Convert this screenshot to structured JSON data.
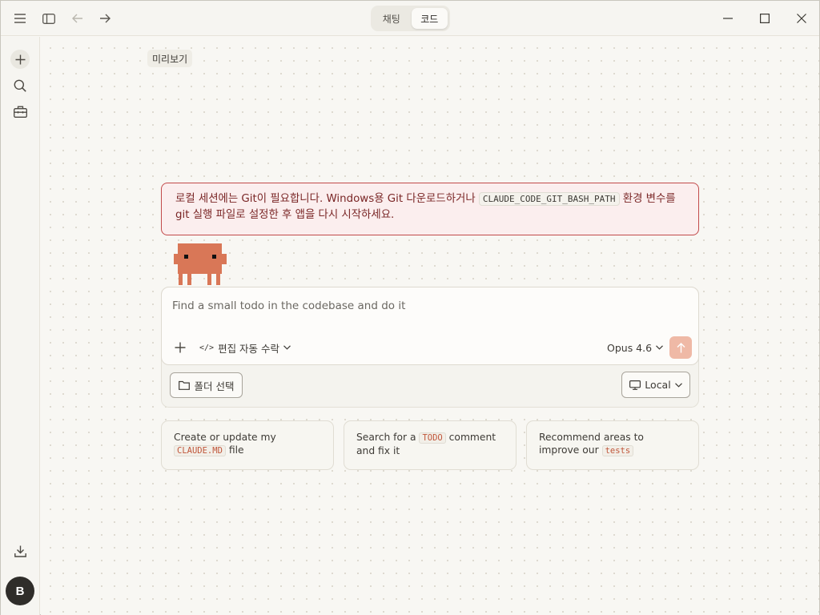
{
  "titlebar": {
    "tabs": [
      {
        "label": "채팅",
        "active": false
      },
      {
        "label": "코드",
        "active": true
      }
    ]
  },
  "icons": {
    "menu": "hamburger-menu-icon",
    "sidebar_toggle": "sidebar-panel-icon",
    "back": "arrow-left-icon",
    "forward": "arrow-right-icon",
    "minimize": "minimize-icon",
    "maximize": "maximize-icon",
    "close": "close-icon",
    "new": "plus-icon",
    "search": "search-icon",
    "tools": "toolbox-icon",
    "download": "download-icon",
    "folder": "folder-icon",
    "monitor": "monitor-icon",
    "send": "arrow-up-icon"
  },
  "sidebar": {
    "avatar_initial": "B"
  },
  "main": {
    "preview_label": "미리보기",
    "error": {
      "text_before": "로컬 세션에는 Git이 필요합니다. Windows용 Git 다운로드하거나",
      "env_var": "CLAUDE_CODE_GIT_BASH_PATH",
      "text_after": "환경 변수를 git 실행 파일로 설정한 후 앱을 다시 시작하세요."
    },
    "composer": {
      "placeholder": "Find a small todo in the codebase and do it",
      "mode_icon": "</>",
      "mode_label": "편집 자동 수락",
      "model_label": "Opus 4.6"
    },
    "folder_button": "폴더 선택",
    "environment_button": "Local",
    "suggestions": [
      {
        "before": "Create or update my",
        "code": "CLAUDE.MD",
        "after": "file"
      },
      {
        "before": "Search for a",
        "code": "TODO",
        "after": "comment and fix it"
      },
      {
        "before": "Recommend areas to improve our",
        "code": "tests",
        "after": ""
      }
    ]
  },
  "colors": {
    "accent": "#d97757",
    "error_border": "#c24a4a",
    "error_bg": "#fbeeee",
    "send_disabled": "#efb9a6"
  }
}
